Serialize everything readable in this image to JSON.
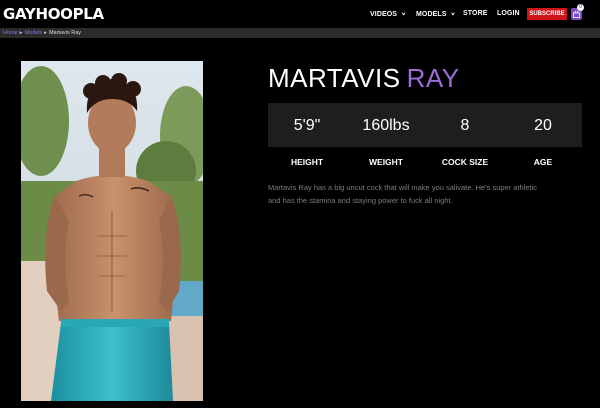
{
  "header": {
    "logo": "GAYHOOPLA",
    "nav": [
      {
        "label": "VIDEOS",
        "has_dropdown": true
      },
      {
        "label": "MODELS",
        "has_dropdown": true
      },
      {
        "label": "STORE",
        "has_dropdown": false
      },
      {
        "label": "LOGIN",
        "has_dropdown": false
      }
    ],
    "subscribe_label": "SUBSCRIBE",
    "cart_count": "0",
    "cart_icon": "shopping-bag-icon",
    "accent_color": "#9a6bdc",
    "subscribe_color": "#d0141c"
  },
  "breadcrumb": {
    "items": [
      "Home",
      "Models"
    ],
    "current": "Martavis Ray",
    "separator": "▸"
  },
  "model": {
    "first_name": "MARTAVIS",
    "last_name": "RAY",
    "stats": [
      {
        "value": "5'9\"",
        "label": "HEIGHT"
      },
      {
        "value": "160lbs",
        "label": "WEIGHT"
      },
      {
        "value": "8",
        "label": "COCK SIZE"
      },
      {
        "value": "20",
        "label": "AGE"
      }
    ],
    "bio": "Martavis Ray has a big uncut cock that will make you salivate. He's super athletic and has the stamina and staying power to fuck all night."
  }
}
